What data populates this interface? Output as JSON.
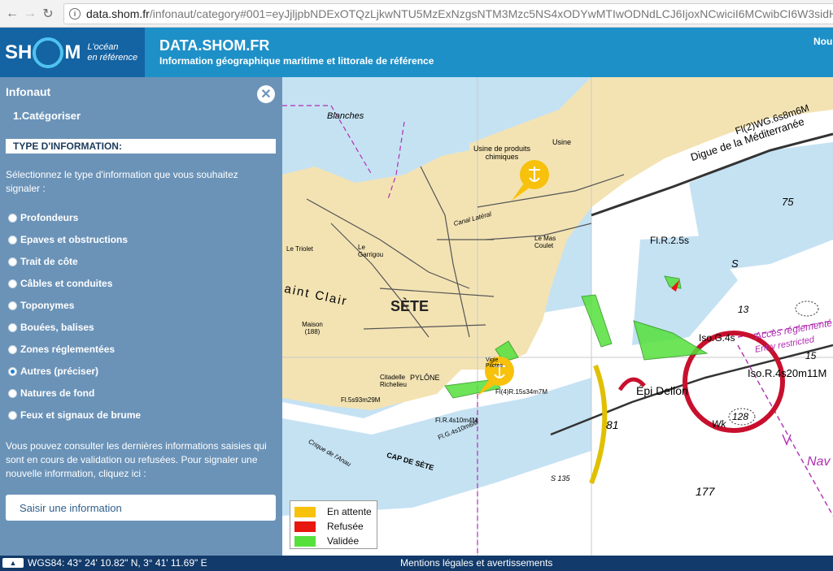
{
  "browser": {
    "url_host": "data.shom.fr",
    "url_path": "/infonaut/category#001=eyJjljpbNDExOTQzLjkwNTU5MzExNzgsNTM3Mzc5NS4xODYwMTIwODNdLCJ6IjoxNCwiciI6MCwibCI6W3sidHlwZSI6IklOVE"
  },
  "header": {
    "logo_text_left": "SH",
    "logo_text_right": "M",
    "logo_tagline_1": "L'océan",
    "logo_tagline_2": "en référence",
    "title": "DATA.SHOM.FR",
    "subtitle": "Information géographique maritime et littorale de référence",
    "nav_partial": "Nou"
  },
  "sidebar": {
    "title": "Infonaut",
    "step": "1.Catégoriser",
    "section_header": "TYPE D'INFORMATION:",
    "intro": "Sélectionnez le type d'information que vous souhaitez signaler :",
    "options": [
      {
        "label": "Profondeurs",
        "checked": false
      },
      {
        "label": "Epaves et obstructions",
        "checked": false
      },
      {
        "label": "Trait de côte",
        "checked": false
      },
      {
        "label": "Câbles et conduites",
        "checked": false
      },
      {
        "label": "Toponymes",
        "checked": false
      },
      {
        "label": "Bouées, balises",
        "checked": false
      },
      {
        "label": "Zones réglementées",
        "checked": false
      },
      {
        "label": "Autres (préciser)",
        "checked": true
      },
      {
        "label": "Natures de fond",
        "checked": false
      },
      {
        "label": "Feux et signaux de brume",
        "checked": false
      }
    ],
    "note": "Vous pouvez consulter les dernières informations saisies qui sont en cours de validation ou refusées. Pour signaler une nouvelle information, cliquez ici :",
    "button_label": "Saisir une information"
  },
  "map": {
    "labels": {
      "blanches": "Blanches",
      "usine_chimique": "Usine de produits chimiques",
      "usine": "Usine",
      "digue": "Digue de la Méditerranée",
      "digue_light": "Fl(2)WG.6s8m6M",
      "sete": "SÈTE",
      "saint_clair": "aint Clair",
      "canal_lateral": "Canal Latéral",
      "le_mas_coulet": "Le Mas Coulet",
      "le_garrigou": "Le Garrigou",
      "le_triolet": "Le Triolet",
      "maison": "Maison (188)",
      "citadelle": "Citadelle Richelieu",
      "pylone": "PYLÔNE",
      "light_left": "Fl.5s93m29M",
      "light_fl4": "Fl(4)R.15s34m7M",
      "light_fr4": "Fl.R.4s10m4M",
      "light_fg4": "Fl.G.4s10m6M",
      "cap_de_sete": "CAP DE SÈTE",
      "crique": "Crique de l'Anau",
      "epi_dellon": "Épi Dellon",
      "fl_r_25": "Fl.R.2.5s",
      "iso_g": "Iso.G.4s",
      "iso_r": "Iso.R.4s20m11M",
      "acces": "Accès réglementé",
      "entry": "Entry restricted",
      "wk": "Wk",
      "nav_partial": "Nav",
      "vigie": "Vigie Pilotes",
      "depth_81": "81",
      "depth_177": "177",
      "depth_75": "75",
      "depth_13": "13",
      "depth_15": "15",
      "depth_128": "128",
      "depth_135": "S 135",
      "depth_s": "S"
    },
    "legend": [
      {
        "label": "En attente",
        "color": "#f7c10c"
      },
      {
        "label": "Refusée",
        "color": "#e8170f"
      },
      {
        "label": "Validée",
        "color": "#55e03c"
      }
    ]
  },
  "footer": {
    "toggle_icon": "▲",
    "coords": "WGS84: 43° 24' 10.82\" N, 3° 41' 11.69\" E",
    "legal": "Mentions légales et avertissements"
  }
}
